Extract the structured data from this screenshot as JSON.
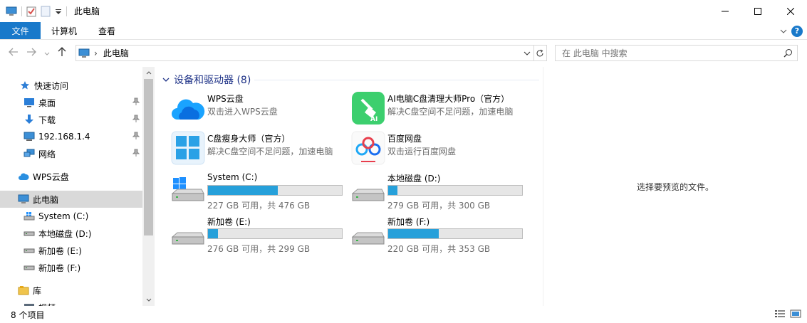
{
  "window": {
    "title": "此电脑"
  },
  "ribbon": {
    "tabs": [
      "文件",
      "计算机",
      "查看"
    ],
    "help": "?"
  },
  "address": {
    "path": "此电脑",
    "search_placeholder": "在 此电脑 中搜索"
  },
  "sidebar": {
    "items": [
      {
        "label": "快速访问",
        "icon": "star-icon"
      },
      {
        "label": "桌面",
        "icon": "desktop-folder-icon",
        "pinned": true
      },
      {
        "label": "下载",
        "icon": "download-arrow-icon",
        "pinned": true
      },
      {
        "label": "192.168.1.4",
        "icon": "network-computer-icon",
        "pinned": true
      },
      {
        "label": "网络",
        "icon": "network-icon",
        "pinned": true
      },
      {
        "label": "WPS云盘",
        "icon": "cloud-icon"
      },
      {
        "label": "此电脑",
        "icon": "computer-icon",
        "selected": true
      },
      {
        "label": "System (C:)",
        "icon": "windows-drive-icon"
      },
      {
        "label": "本地磁盘 (D:)",
        "icon": "drive-icon"
      },
      {
        "label": "新加卷 (E:)",
        "icon": "drive-icon"
      },
      {
        "label": "新加卷 (F:)",
        "icon": "drive-icon"
      },
      {
        "label": "库",
        "icon": "library-icon"
      },
      {
        "label": "视频",
        "icon": "video-library-icon"
      }
    ]
  },
  "main": {
    "group_title": "设备和驱动器 (8)",
    "apps": [
      {
        "name": "WPS云盘",
        "sub": "双击进入WPS云盘",
        "icon": "wps-cloud-icon"
      },
      {
        "name": "AI电脑C盘清理大师Pro（官方）",
        "sub": "解决C盘空间不足问题，加速电脑",
        "icon": "ai-cleaner-icon"
      },
      {
        "name": "C盘瘦身大师（官方）",
        "sub": "解决C盘空间不足问题，加速电脑",
        "icon": "c-slim-icon"
      },
      {
        "name": "百度网盘",
        "sub": "双击运行百度网盘",
        "icon": "baidu-netdisk-icon"
      }
    ],
    "drives": [
      {
        "name": "System (C:)",
        "sub": "227 GB 可用，共 476 GB",
        "used_fraction": 0.523,
        "icon": "windows-drive-icon"
      },
      {
        "name": "本地磁盘 (D:)",
        "sub": "279 GB 可用，共 300 GB",
        "used_fraction": 0.07,
        "icon": "drive-icon"
      },
      {
        "name": "新加卷 (E:)",
        "sub": "276 GB 可用，共 299 GB",
        "used_fraction": 0.077,
        "icon": "drive-icon"
      },
      {
        "name": "新加卷 (F:)",
        "sub": "220 GB 可用，共 353 GB",
        "used_fraction": 0.377,
        "icon": "drive-icon"
      }
    ]
  },
  "preview": {
    "message": "选择要预览的文件。"
  },
  "status": {
    "count": "8 个项目"
  }
}
